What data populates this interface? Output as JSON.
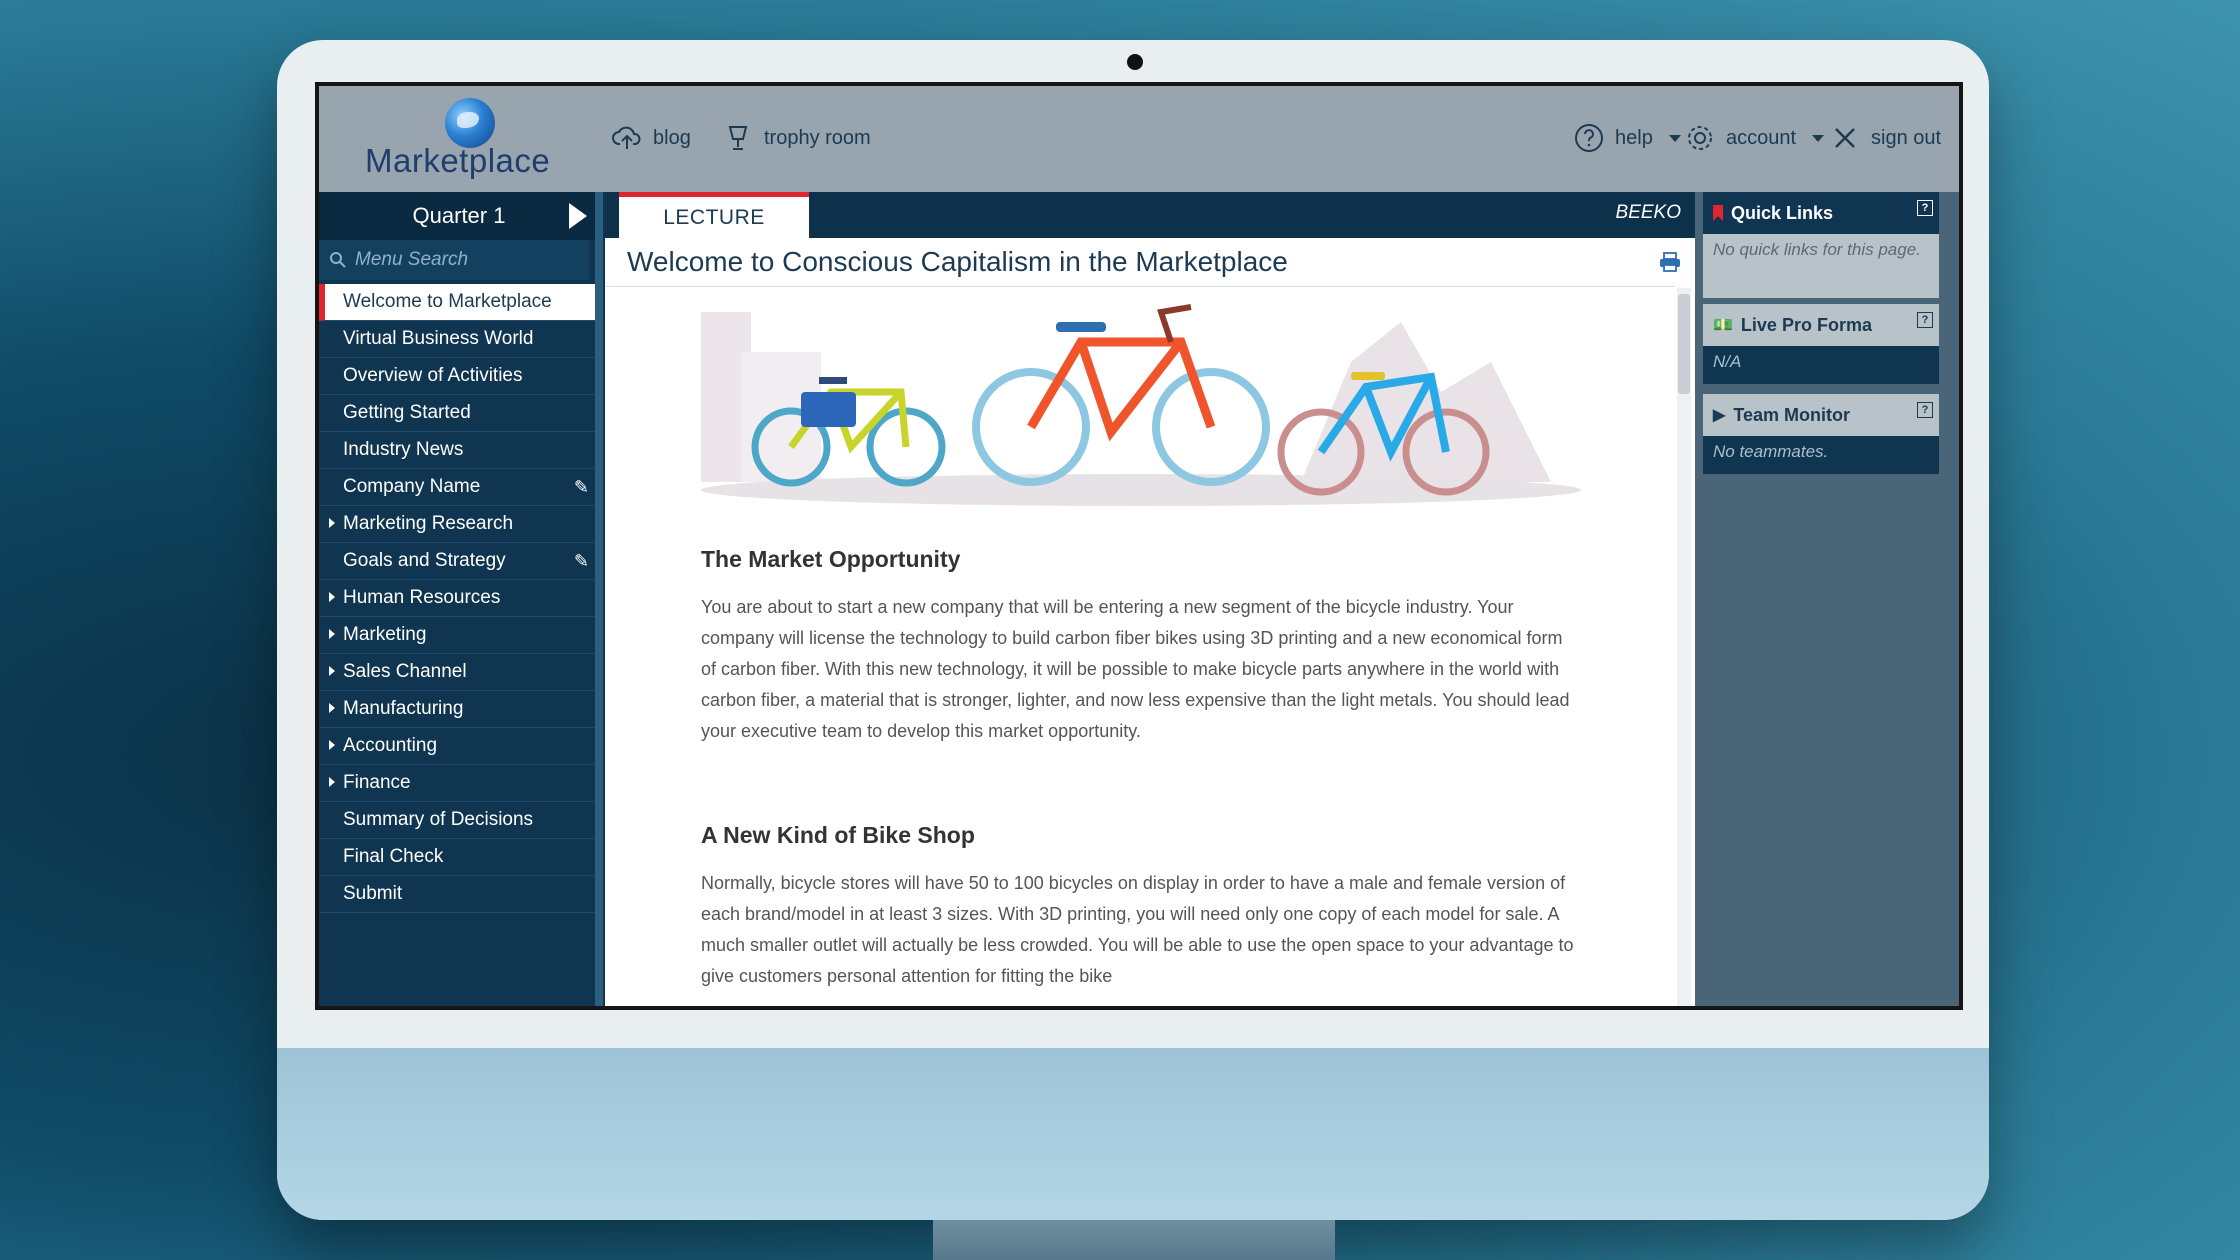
{
  "app": {
    "logo_text": "Marketplace",
    "accent_color": "#e0262e",
    "nav_bg": "#0f3550"
  },
  "topbar": {
    "blog": "blog",
    "trophy_room": "trophy room",
    "help": "help",
    "account": "account",
    "sign_out": "sign out"
  },
  "sidebar": {
    "quarter": "Quarter 1",
    "search_placeholder": "Menu Search",
    "items": [
      {
        "label": "Welcome to Marketplace",
        "active": true
      },
      {
        "label": "Virtual Business World"
      },
      {
        "label": "Overview of Activities"
      },
      {
        "label": "Getting Started"
      },
      {
        "label": "Industry News"
      },
      {
        "label": "Company Name",
        "editable": true
      },
      {
        "label": "Marketing Research",
        "expandable": true
      },
      {
        "label": "Goals and Strategy",
        "editable": true
      },
      {
        "label": "Human Resources",
        "expandable": true
      },
      {
        "label": "Marketing",
        "expandable": true
      },
      {
        "label": "Sales Channel",
        "expandable": true
      },
      {
        "label": "Manufacturing",
        "expandable": true
      },
      {
        "label": "Accounting",
        "expandable": true
      },
      {
        "label": "Finance",
        "expandable": true
      },
      {
        "label": "Summary of Decisions"
      },
      {
        "label": "Final Check"
      },
      {
        "label": "Submit"
      }
    ]
  },
  "center": {
    "tab": "LECTURE",
    "company": "BEEKO",
    "title": "Welcome to Conscious Capitalism in the Marketplace",
    "section1_heading": "The Market Opportunity",
    "section1_text": "You are about to start a new company that will be entering a new segment of the bicycle industry. Your company will license the technology to build carbon fiber bikes using 3D printing and a new economical form of carbon fiber. With this new technology, it will be possible to make bicycle parts anywhere in the world with carbon fiber, a material that is stronger, lighter, and now less expensive than the light metals. You should lead your executive team to develop this market opportunity.",
    "section2_heading": "A New Kind of Bike Shop",
    "section2_text": "Normally, bicycle stores will have 50 to 100 bicycles on display in order to have a male and female version of each brand/model in at least 3 sizes. With 3D printing, you will need only one copy of each model for sale. A much smaller outlet will actually be less crowded. You will be able to use the open space to your advantage to give customers personal attention for fitting the bike"
  },
  "rightpanel": {
    "quick_links": {
      "title": "Quick Links",
      "body": "No quick links for this page."
    },
    "live_pro_forma": {
      "title": "Live Pro Forma",
      "body": "N/A"
    },
    "team_monitor": {
      "title": "Team Monitor",
      "body": "No teammates."
    }
  }
}
